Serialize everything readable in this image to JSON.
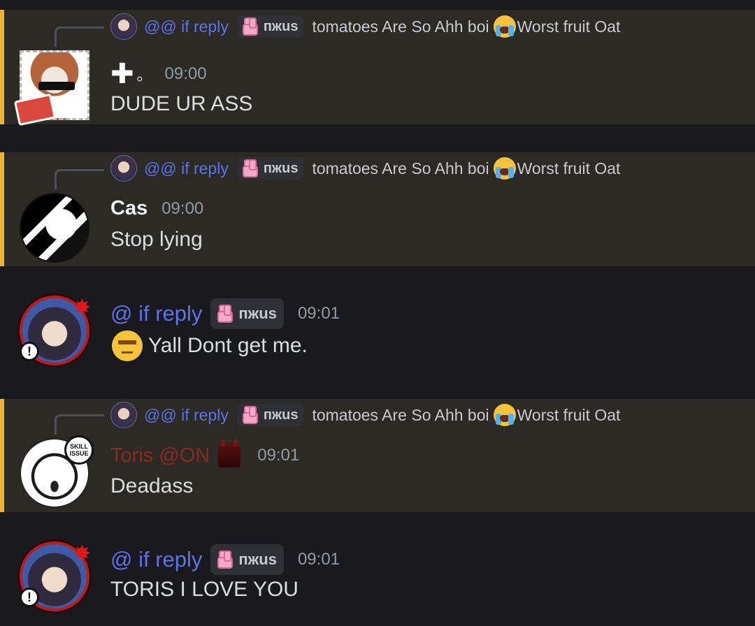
{
  "reply_preview": {
    "author": "@@ if reply",
    "tag": "пжus",
    "text_before_emoji": "tomatoes Are So Ahh boi",
    "emoji": "loudly-crying-face",
    "text_after_emoji": "Worst fruit Oat"
  },
  "messages": [
    {
      "highlighted": true,
      "has_reply": true,
      "author_prefix": "✚",
      "author_suffix": "。",
      "time": "09:00",
      "content": "DUDE UR ASS"
    },
    {
      "highlighted": true,
      "has_reply": true,
      "author": "Cas",
      "time": "09:00",
      "content": "Stop lying"
    },
    {
      "highlighted": false,
      "has_reply": false,
      "author": "@ if reply",
      "tag": "пжus",
      "time": "09:01",
      "content_emoji": "unamused-face",
      "content": "Yall Dont get me."
    },
    {
      "highlighted": true,
      "has_reply": true,
      "author": "Toris @ON",
      "author_color": "#8c2a1c",
      "time": "09:01",
      "content": "Deadass",
      "avatar_badge": "SKILL ISSUE"
    },
    {
      "highlighted": false,
      "has_reply": false,
      "author": "@ if reply",
      "tag": "пжus",
      "time": "09:01",
      "content": "TORIS I LOVE YOU"
    }
  ],
  "colors": {
    "background": "#1a1a1e",
    "highlight_bg": "#2b2a25",
    "highlight_bar": "#f0b232",
    "mention_blue": "#5d72e8",
    "timestamp": "#949ba4"
  }
}
